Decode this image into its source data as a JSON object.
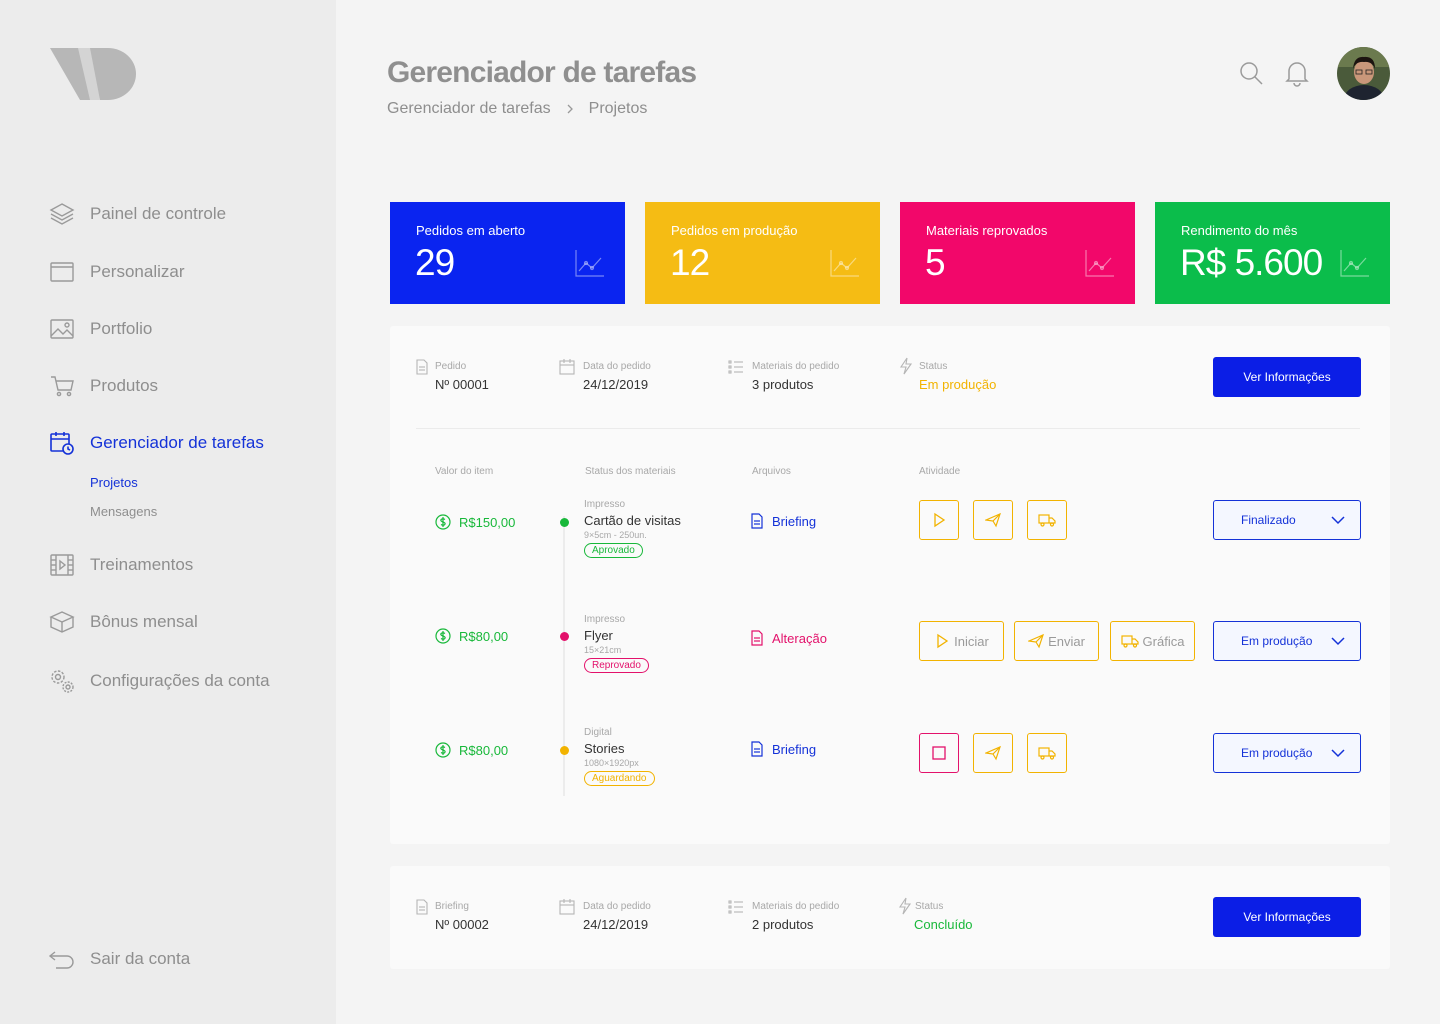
{
  "sidebar": {
    "nav": [
      {
        "label": "Painel de controle",
        "icon": "layers-icon"
      },
      {
        "label": "Personalizar",
        "icon": "browser-window-icon"
      },
      {
        "label": "Portfolio",
        "icon": "image-icon"
      },
      {
        "label": "Produtos",
        "icon": "cart-icon"
      },
      {
        "label": "Gerenciador de tarefas",
        "icon": "calendar-clock-icon"
      },
      {
        "label": "Treinamentos",
        "icon": "film-icon"
      },
      {
        "label": "Bônus mensal",
        "icon": "box-icon"
      },
      {
        "label": "Configurações da conta",
        "icon": "gears-icon"
      }
    ],
    "sub": [
      "Projetos",
      "Mensagens"
    ],
    "logout": "Sair da conta"
  },
  "header": {
    "title": "Gerenciador de tarefas",
    "breadcrumb": [
      "Gerenciador de tarefas",
      "Projetos"
    ]
  },
  "stats": [
    {
      "label": "Pedidos em aberto",
      "value": "29",
      "color": "#0a24f0"
    },
    {
      "label": "Pedidos em produção",
      "value": "12",
      "color": "#f5bc14"
    },
    {
      "label": "Materiais reprovados",
      "value": "5",
      "color": "#f2076a"
    },
    {
      "label": "Rendimento do mês",
      "value": "R$ 5.600",
      "color": "#0bbd4b"
    }
  ],
  "order1": {
    "fields": [
      {
        "label": "Pedido",
        "value": "Nº 00001"
      },
      {
        "label": "Data do pedido",
        "value": "24/12/2019"
      },
      {
        "label": "Materiais do pedido",
        "value": "3 produtos"
      },
      {
        "label": "Status",
        "value": "Em produção"
      }
    ],
    "button": "Ver Informações",
    "columns": [
      "Valor do item",
      "Status dos materiais",
      "Arquivos",
      "Atividade"
    ],
    "items": [
      {
        "price": "R$150,00",
        "type": "Impresso",
        "name": "Cartão de visitas",
        "spec": "9×5cm - 250un.",
        "badge": "Aprovado",
        "file": "Briefing",
        "status": "Finalizado"
      },
      {
        "price": "R$80,00",
        "type": "Impresso",
        "name": "Flyer",
        "spec": "15×21cm",
        "badge": "Reprovado",
        "file": "Alteração",
        "status": "Em produção",
        "actions": [
          "Iniciar",
          "Enviar",
          "Gráfica"
        ]
      },
      {
        "price": "R$80,00",
        "type": "Digital",
        "name": "Stories",
        "spec": "1080×1920px",
        "badge": "Aguardando",
        "file": "Briefing",
        "status": "Em produção"
      }
    ]
  },
  "order2": {
    "fields": [
      {
        "label": "Briefing",
        "value": "Nº 00002"
      },
      {
        "label": "Data do pedido",
        "value": "24/12/2019"
      },
      {
        "label": "Materiais do pedido",
        "value": "2 produtos"
      },
      {
        "label": "Status",
        "value": "Concluído"
      }
    ],
    "button": "Ver Informações"
  },
  "colors": {
    "accent": "#1432d8",
    "green": "#18b83a",
    "yellow": "#f2b300",
    "pink": "#e3116b"
  }
}
